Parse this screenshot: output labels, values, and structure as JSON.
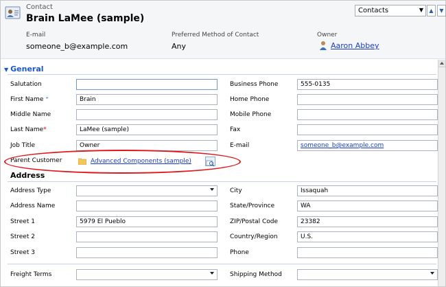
{
  "header": {
    "entity_type": "Contact",
    "record_title": "Brain LaMee (sample)",
    "form_selector": "Contacts",
    "email_label": "E-mail",
    "email_value": "someone_b@example.com",
    "pref_label": "Preferred Method of Contact",
    "pref_value": "Any",
    "owner_label": "Owner",
    "owner_value": "Aaron Abbey"
  },
  "general": {
    "section_title": "General",
    "salutation_label": "Salutation",
    "salutation_value": "",
    "first_name_label": "First Name",
    "first_name_value": "Brain",
    "middle_name_label": "Middle Name",
    "middle_name_value": "",
    "last_name_label": "Last Name",
    "last_name_value": "LaMee (sample)",
    "job_title_label": "Job Title",
    "job_title_value": "Owner",
    "parent_customer_label": "Parent Customer",
    "parent_customer_value": "Advanced Components (sample)",
    "business_phone_label": "Business Phone",
    "business_phone_value": "555-0135",
    "home_phone_label": "Home Phone",
    "home_phone_value": "",
    "mobile_phone_label": "Mobile Phone",
    "mobile_phone_value": "",
    "fax_label": "Fax",
    "fax_value": "",
    "email_label": "E-mail",
    "email_value": "someone_b@example.com"
  },
  "address": {
    "section_title": "Address",
    "address_type_label": "Address Type",
    "address_type_value": "",
    "address_name_label": "Address Name",
    "address_name_value": "",
    "street1_label": "Street 1",
    "street1_value": "5979 El Pueblo",
    "street2_label": "Street 2",
    "street2_value": "",
    "street3_label": "Street 3",
    "street3_value": "",
    "city_label": "City",
    "city_value": "Issaquah",
    "state_label": "State/Province",
    "state_value": "WA",
    "zip_label": "ZIP/Postal Code",
    "zip_value": "23382",
    "country_label": "Country/Region",
    "country_value": "U.S.",
    "phone_label": "Phone",
    "phone_value": "",
    "freight_label": "Freight Terms",
    "freight_value": "",
    "shipping_label": "Shipping Method",
    "shipping_value": ""
  },
  "colors": {
    "accent": "#1b57c4",
    "annotation": "#e0141b",
    "link": "#1a3cc5"
  },
  "icons": [
    "contact-card-icon",
    "user-icon",
    "folder-icon",
    "lookup-icon",
    "arrow-up-icon",
    "arrow-down-icon",
    "chevron-down-icon"
  ]
}
